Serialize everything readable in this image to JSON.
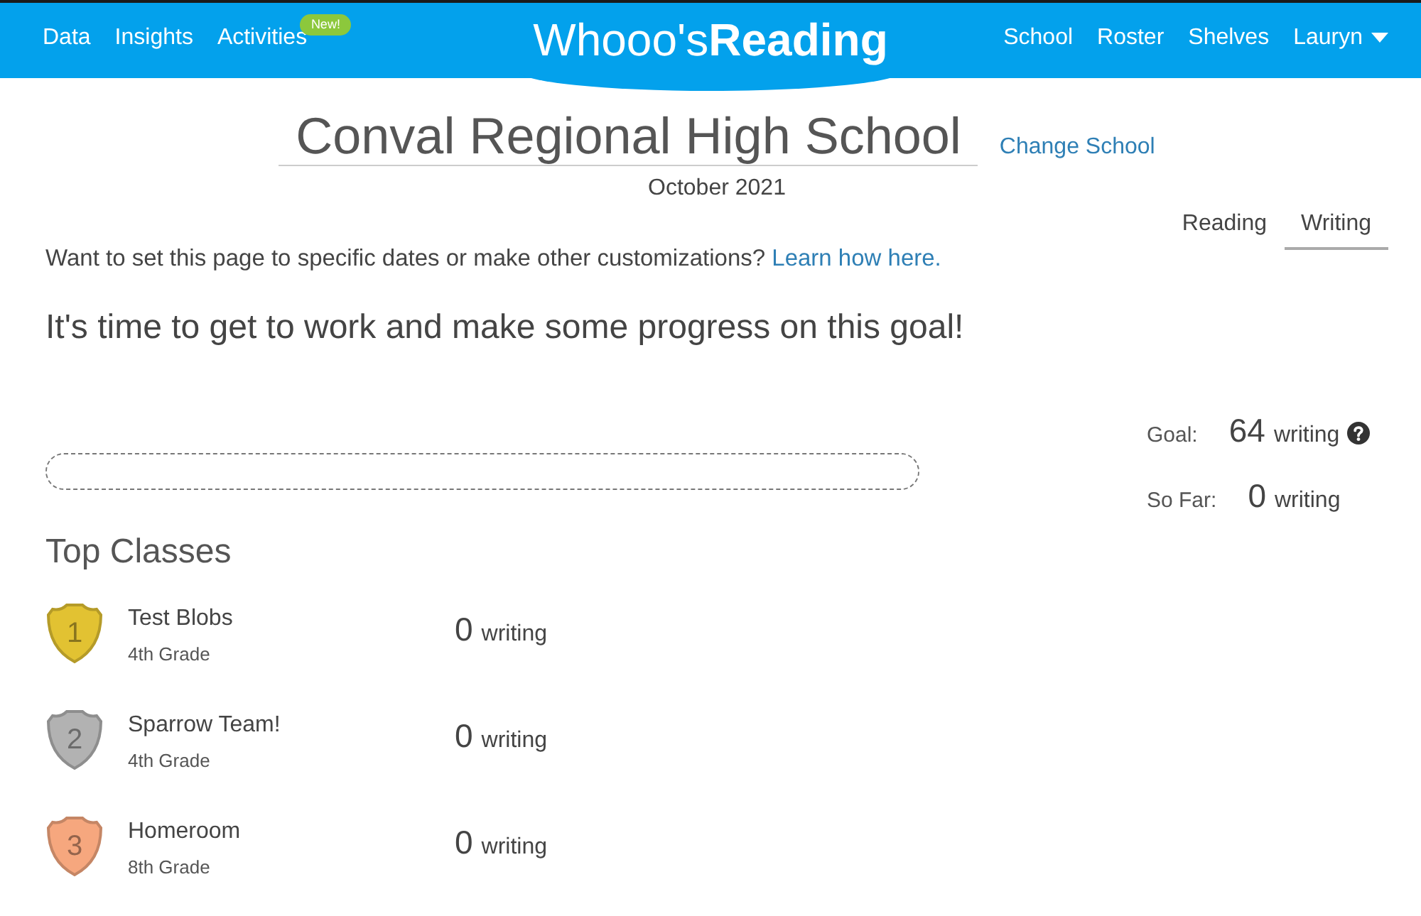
{
  "nav": {
    "left_items": [
      {
        "label": "Data"
      },
      {
        "label": "Insights"
      },
      {
        "label": "Activities",
        "badge": "New!"
      }
    ],
    "logo": "Whooo's**Reading**",
    "right_items": [
      {
        "label": "School"
      },
      {
        "label": "Roster"
      },
      {
        "label": "Shelves"
      }
    ],
    "user_menu": {
      "label": "Lauryn"
    }
  },
  "school": {
    "name": "Conval Regional High School",
    "change_link": "Change School",
    "period": "October 2021"
  },
  "tabs": [
    {
      "label": "Reading",
      "selected": false
    },
    {
      "label": "Writing",
      "selected": true
    }
  ],
  "customize_note": {
    "text": "Want to set this page to specific dates or make other customizations?",
    "link": "Learn how here."
  },
  "message": "It's time to get to work and make some progress on this goal!",
  "stats": [
    {
      "label": "Goal:",
      "value": "64",
      "unit": "writing",
      "help": true
    },
    {
      "label": "So Far:",
      "value": "0",
      "unit": "writing",
      "help": false
    }
  ],
  "top_classes": {
    "title": "Top Classes",
    "classes": [
      {
        "rank": "1",
        "color": "#e2c232",
        "name": "Test Blobs",
        "grade": "4th Grade",
        "count": "0",
        "unit": "writing"
      },
      {
        "rank": "2",
        "color": "#b2b2b2",
        "name": "Sparrow Team!",
        "grade": "4th Grade",
        "count": "0",
        "unit": "writing"
      },
      {
        "rank": "3",
        "color": "#f6a77e",
        "name": "Homeroom",
        "grade": "8th Grade",
        "count": "0",
        "unit": "writing"
      }
    ]
  }
}
